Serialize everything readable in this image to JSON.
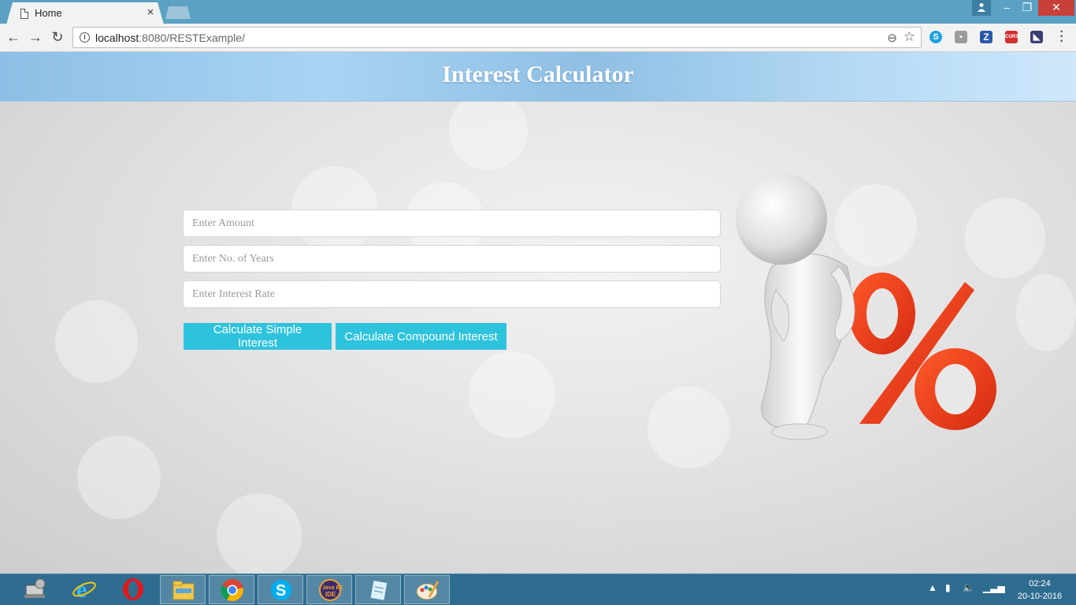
{
  "browser": {
    "tab_title": "Home",
    "tab_close": "×",
    "url_host": "localhost",
    "url_rest": ":8080/RESTExample/",
    "ext_cors": "CORS",
    "ext_z": "Z"
  },
  "window_controls": {
    "minimize": "–",
    "maximize": "❐",
    "close": "✕"
  },
  "page": {
    "title": "Interest Calculator",
    "amount_placeholder": "Enter Amount",
    "years_placeholder": "Enter No. of Years",
    "rate_placeholder": "Enter Interest Rate",
    "simple_button": "Calculate Simple Interest",
    "compound_button": "Calculate Compound Interest"
  },
  "colors": {
    "accent_button": "#2ec3dd",
    "header_band": "#a9d3f2",
    "percent_red": "#e8341c"
  },
  "taskbar": {
    "items": [
      "computer-icon",
      "internet-explorer-icon",
      "opera-icon",
      "file-explorer-icon",
      "chrome-icon",
      "skype-icon",
      "java-ee-ide-icon",
      "notepad-icon",
      "paint-icon"
    ],
    "clock_time": "02:24",
    "clock_date": "20-10-2016"
  }
}
